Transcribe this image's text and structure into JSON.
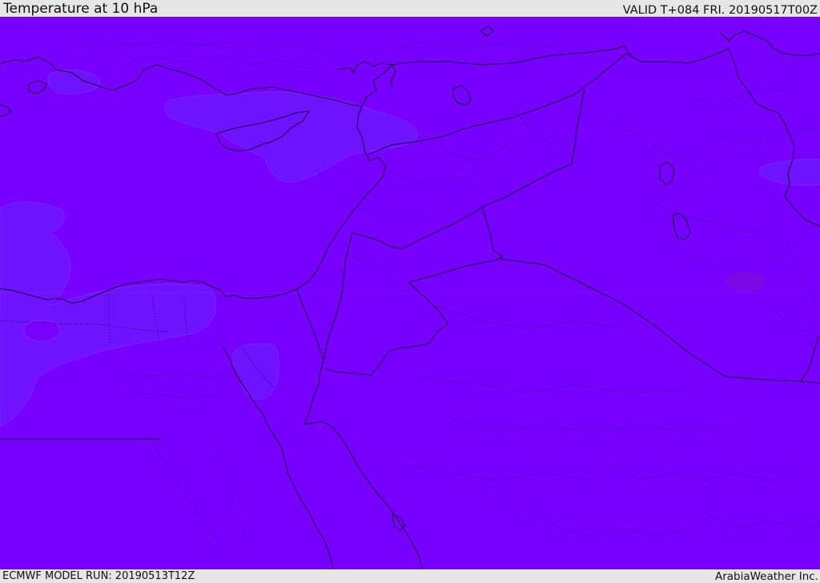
{
  "header": {
    "title": "Temperature at 10 hPa",
    "valid": "VALID T+084 FRI. 20190517T00Z"
  },
  "footer": {
    "model_run": "ECMWF MODEL RUN: 20190513T12Z",
    "credit": "ArabiaWeather Inc."
  },
  "map": {
    "field": "temperature",
    "level": "10 hPa",
    "colors": {
      "dominant_fill": "#7800ff",
      "cooler_fill": "#6e13ff",
      "warmer_fill": "#7c08e6",
      "coastline": "#1a0033",
      "border": "#1a0033"
    }
  }
}
